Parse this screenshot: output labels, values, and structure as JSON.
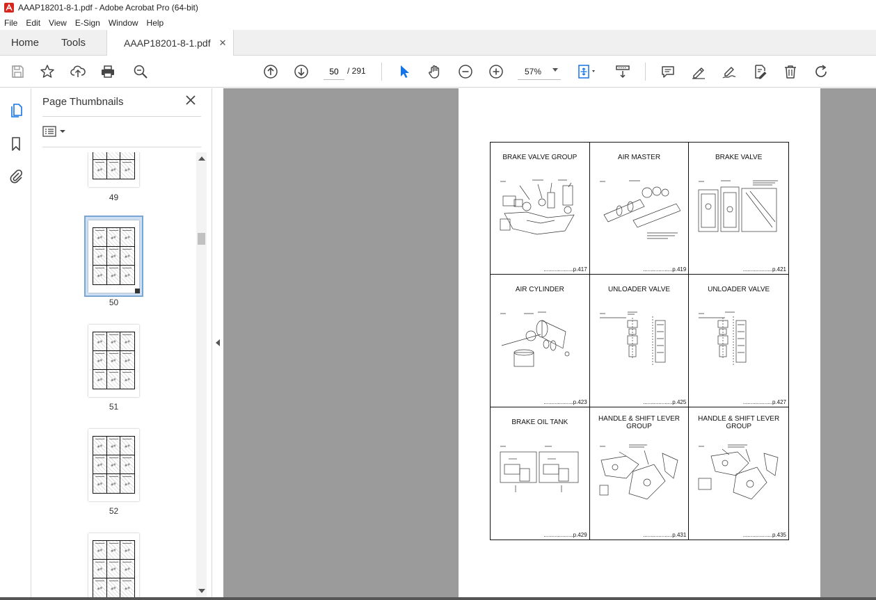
{
  "window": {
    "title": "AAAP18201-8-1.pdf - Adobe Acrobat Pro (64-bit)"
  },
  "menu": [
    "File",
    "Edit",
    "View",
    "E-Sign",
    "Window",
    "Help"
  ],
  "tabs": {
    "home": "Home",
    "tools": "Tools",
    "document": "AAAP18201-8-1.pdf",
    "close_glyph": "✕"
  },
  "toolbar": {
    "current_page": "50",
    "total_pages": "/  291",
    "zoom": "57%",
    "icons": [
      "save-icon",
      "bookmark-star-icon",
      "upload-icon",
      "print-icon",
      "zoom-search-icon",
      "prev-page-icon",
      "next-page-icon",
      "select-cursor-icon",
      "hand-icon",
      "zoom-out-icon",
      "zoom-in-icon",
      "fit-page-icon",
      "scroll-mode-icon",
      "comment-icon",
      "highlight-pen-icon",
      "sign-icon",
      "edit-pdf-icon",
      "delete-icon",
      "rotate-icon"
    ]
  },
  "left_rail": {
    "icons": [
      "page-thumbnails-icon",
      "bookmarks-icon",
      "attachments-icon"
    ]
  },
  "thumbnail_panel": {
    "title": "Page Thumbnails",
    "thumbnails": [
      {
        "page": "49",
        "selected": false
      },
      {
        "page": "50",
        "selected": true
      },
      {
        "page": "51",
        "selected": false
      },
      {
        "page": "52",
        "selected": false
      }
    ]
  },
  "document_page": {
    "cells": [
      {
        "title": "BRAKE VALVE GROUP",
        "ref": "...................p.417"
      },
      {
        "title": "AIR MASTER",
        "ref": "...................p.419"
      },
      {
        "title": "BRAKE VALVE",
        "ref": "...................p.421"
      },
      {
        "title": "AIR CYLINDER",
        "ref": "...................p.423"
      },
      {
        "title": "UNLOADER VALVE",
        "ref": "...................p.425"
      },
      {
        "title": "UNLOADER VALVE",
        "ref": "...................p.427"
      },
      {
        "title": "BRAKE OIL TANK",
        "ref": "...................p.429"
      },
      {
        "title": "HANDLE & SHIFT LEVER GROUP",
        "ref": "...................p.431"
      },
      {
        "title": "HANDLE & SHIFT LEVER GROUP",
        "ref": "...................p.435"
      }
    ]
  },
  "colors": {
    "doc_background": "#9b9b9b",
    "selected_thumb": "#cfe0f4",
    "acrobat_red": "#d7261e",
    "cursor_blue": "#1473e6"
  }
}
